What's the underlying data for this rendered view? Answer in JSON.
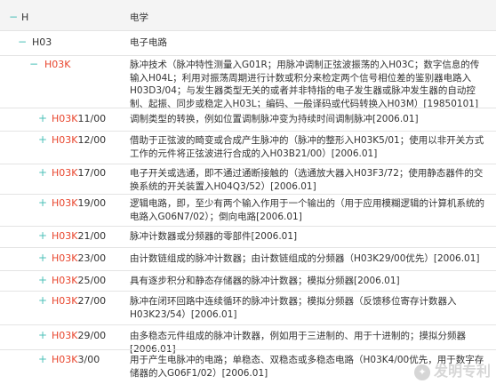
{
  "rows": [
    {
      "sign": "−",
      "code_red": "",
      "code_rest": "H",
      "desc": "电学"
    },
    {
      "sign": "−",
      "code_red": "",
      "code_rest": "H03",
      "desc": "电子电路"
    },
    {
      "sign": "−",
      "code_red": "H03K",
      "code_rest": "",
      "desc": "脉冲技术（脉冲特性测量入G01R；用脉冲调制正弦波振荡的入H03C；数字信息的传输入H04L；利用对振荡周期进行计数或积分来检定两个信号相位差的鉴别器电路入H03D3/04；与发生器类型无关的或者并非特指的电子发生器或脉冲发生器的自动控制、起振、同步或稳定入H03L；编码、一般译码或代码转换入H03M）[19850101]"
    },
    {
      "sign": "+",
      "code_red": "H03K",
      "code_rest": "11/00",
      "desc": "调制类型的转换，例如位置调制脉冲变为持续时间调制脉冲[2006.01]"
    },
    {
      "sign": "+",
      "code_red": "H03K",
      "code_rest": "12/00",
      "desc": "借助于正弦波的畸变或合成产生脉冲的（脉冲的整形入H03K5/01；使用以非开关方式工作的元件将正弦波进行合成的入H03B21/00）[2006.01]"
    },
    {
      "sign": "+",
      "code_red": "H03K",
      "code_rest": "17/00",
      "desc": "电子开关或选通，即不通过通断接触的（选通放大器入H03F3/72；使用静态器件的交换系统的开关装置入H04Q3/52）[2006.01]"
    },
    {
      "sign": "+",
      "code_red": "H03K",
      "code_rest": "19/00",
      "desc": "逻辑电路，即，至少有两个输入作用于一个输出的（用于应用模糊逻辑的计算机系统的电路入G06N7/02）；倒向电路[2006.01]"
    },
    {
      "sign": "+",
      "code_red": "H03K",
      "code_rest": "21/00",
      "desc": "脉冲计数器或分频器的零部件[2006.01]"
    },
    {
      "sign": "+",
      "code_red": "H03K",
      "code_rest": "23/00",
      "desc": "由计数链组成的脉冲计数器；由计数链组成的分频器（H03K29/00优先）[2006.01]"
    },
    {
      "sign": "+",
      "code_red": "H03K",
      "code_rest": "25/00",
      "desc": "具有逐步积分和静态存储器的脉冲计数器；模拟分频器[2006.01]"
    },
    {
      "sign": "+",
      "code_red": "H03K",
      "code_rest": "27/00",
      "desc": "脉冲在闭环回路中连续循环的脉冲计数器；模拟分频器（反馈移位寄存计数器入H03K23/54）[2006.01]"
    },
    {
      "sign": "+",
      "code_red": "H03K",
      "code_rest": "29/00",
      "desc": "由多稳态元件组成的脉冲计数器，例如用于三进制的、用于十进制的；摸拟分频器[2006.01]"
    },
    {
      "sign": "+",
      "code_red": "H03K",
      "code_rest": "3/00",
      "desc": "用于产生电脉冲的电路；单稳态、双稳态或多稳态电路（H03K4/00优先，用于数字存储器的入G06F1/02）[2006.01]"
    }
  ],
  "watermark": "发明专利",
  "watermark_icon": "wechat-icon"
}
